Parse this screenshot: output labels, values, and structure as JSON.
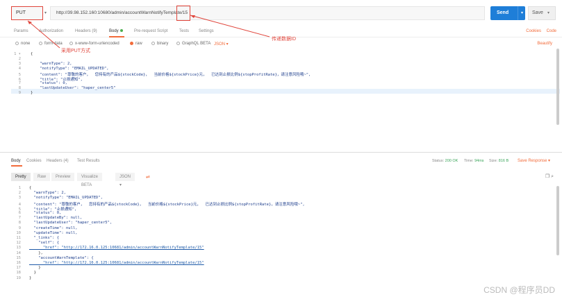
{
  "request": {
    "method": "PUT",
    "url": "http://39.98.152.160:10680/admin/accountWarnNotifyTemplate/15",
    "send_label": "Send",
    "save_label": "Save"
  },
  "request_tabs": [
    {
      "label": "Params"
    },
    {
      "label": "Authorization"
    },
    {
      "label": "Headers (9)"
    },
    {
      "label": "Body"
    },
    {
      "label": "Pre-request Script"
    },
    {
      "label": "Tests"
    },
    {
      "label": "Settings"
    }
  ],
  "right_links": {
    "cookies": "Cookies",
    "code": "Code"
  },
  "body_options": [
    {
      "label": "none"
    },
    {
      "label": "form-data"
    },
    {
      "label": "x-www-form-urlencoded"
    },
    {
      "label": "raw"
    },
    {
      "label": "binary"
    },
    {
      "label": "GraphQL BETA"
    }
  ],
  "body_format": "JSON",
  "beautify": "Beautify",
  "annotations": {
    "method_note": "采用PUT方式",
    "id_note": "传递数据ID"
  },
  "request_body_lines": [
    "{",
    "",
    "    \"warnType\": 2,",
    "    \"notifyType\": \"EMAIL_UPDATED\",",
    "    \"content\": \"尊敬的客户，  您持有的产品${stockCode}，  当前价格${stockPrice}元，  已达到止损比例${stopProfitRate}，请注意风险哦~\",",
    "    \"title\": \"止损通知\",",
    "    \"status\": 0,",
    "    \"lastUpdateUser\": \"haper_center5\"",
    "}"
  ],
  "response_tabs": [
    {
      "label": "Body"
    },
    {
      "label": "Cookies"
    },
    {
      "label": "Headers (4)"
    },
    {
      "label": "Test Results"
    }
  ],
  "response_status": {
    "status_label": "Status:",
    "status_value": "200 OK",
    "time_label": "Time:",
    "time_value": "94ms",
    "size_label": "Size:",
    "size_value": "816 B",
    "save_response": "Save Response"
  },
  "view_modes": [
    {
      "label": "Pretty"
    },
    {
      "label": "Raw"
    },
    {
      "label": "Preview"
    },
    {
      "label": "Visualize BETA"
    }
  ],
  "response_format": "JSON",
  "response_body_lines": [
    "{",
    "  \"warnType\": 2,",
    "  \"notifyType\": \"EMAIL_UPDATED\",",
    "  \"content\": \"尊敬的客户，  您持有的产品${stockCode}，  当前价格${stockPrice}元，  已达到止损比例${stopProfitRate}，请注意风险哦~\",",
    "  \"title\": \"止损通知\",",
    "  \"status\": 0,",
    "  \"lastUpdateBy\": null,",
    "  \"lastUpdateUser\": \"haper_center5\",",
    "  \"createTime\": null,",
    "  \"updateTime\": null,",
    "  \"_links\": {",
    "    \"self\": {",
    "      \"href\": \"http://172.16.0.125:10681/admin/accountWarnNotifyTemplate/15\"",
    "    },",
    "    \"accountWarnTemplate\": {",
    "      \"href\": \"http://172.16.0.125:10681/admin/accountWarnNotifyTemplate/15\"",
    "    }",
    "  }",
    "}"
  ],
  "watermark": "CSDN @程序员DD",
  "colors": {
    "accent": "#f26b3a",
    "send": "#1e7ed8",
    "annotation": "#e0443a",
    "status_ok": "#3aa55a"
  }
}
